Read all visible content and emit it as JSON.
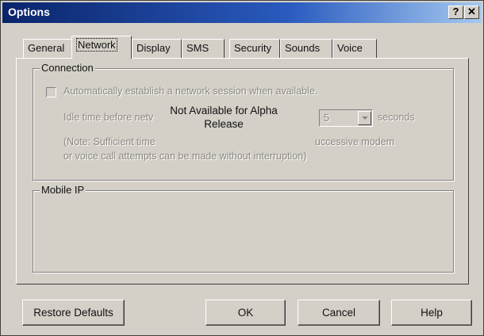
{
  "window": {
    "title": "Options",
    "help_glyph": "?",
    "close_glyph": "✕"
  },
  "tabs": [
    "General",
    "Network",
    "Display",
    "SMS",
    "Security",
    "Sounds",
    "Voice"
  ],
  "active_tab": "Network",
  "connection": {
    "group_label": "Connection",
    "auto_session_label": "Automatically establish a network session when available.",
    "auto_session_checked": false,
    "idle_label": "Idle time before netv",
    "idle_value": "5",
    "idle_unit": "seconds",
    "note_line1_a": "(Note: Sufficient time",
    "note_line1_b": "uccessive modem",
    "note_line2": "or voice call attempts can be made without interruption)",
    "overlay_line1": "Not Available for Alpha",
    "overlay_line2": "Release"
  },
  "mobile_ip": {
    "group_label": "Mobile IP"
  },
  "buttons": {
    "restore_defaults": "Restore Defaults",
    "ok": "OK",
    "cancel": "Cancel",
    "help": "Help"
  }
}
